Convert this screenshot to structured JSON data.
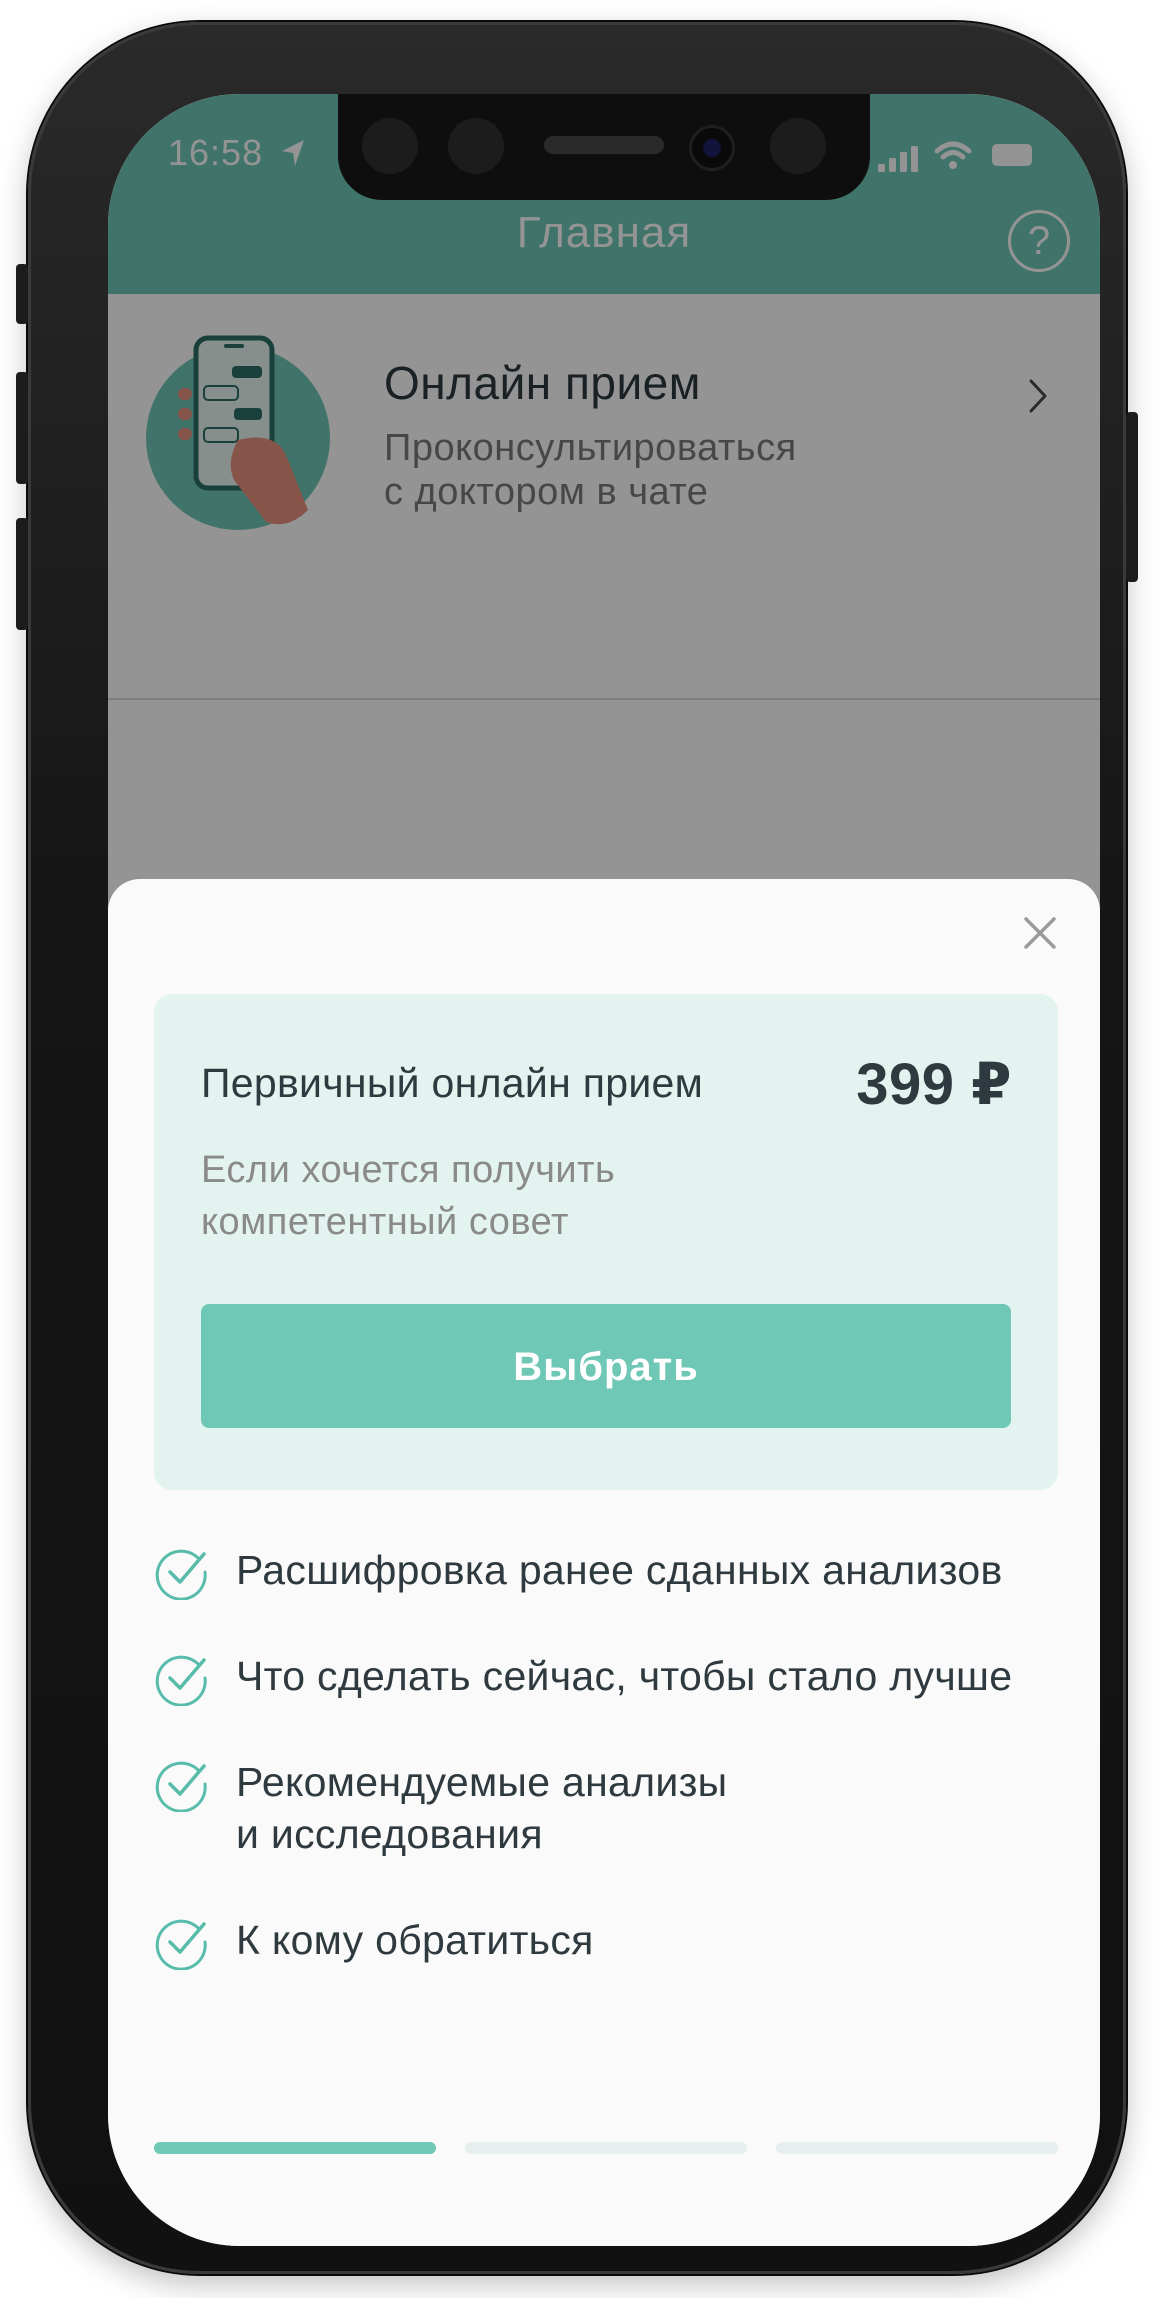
{
  "status_bar": {
    "time": "16:58"
  },
  "header": {
    "title": "Главная",
    "help_label": "?"
  },
  "online_card": {
    "title": "Онлайн прием",
    "subtitle": "Проконсультироваться\nс доктором в чате"
  },
  "offer": {
    "title": "Первичный онлайн прием",
    "price": "399 ₽",
    "description": "Если хочется получить\nкомпетентный совет",
    "choose_label": "Выбрать"
  },
  "features": [
    {
      "text": "Расшифровка ранее сданных анализов"
    },
    {
      "text": "Что сделать сейчас, чтобы стало лучше"
    },
    {
      "text": "Рекомендуемые анализы\nи исследования"
    },
    {
      "text": "К кому обратиться"
    }
  ],
  "pager": {
    "total": 3,
    "active_index": 0
  },
  "colors": {
    "accent": "#6fc7b5",
    "offer_background": "#e3f4f0",
    "text_dark": "#2e3a3f",
    "text_muted": "#8a8a8a"
  },
  "icons": {
    "location": "location-arrow-icon",
    "signal": "cellular-signal-icon",
    "wifi": "wifi-icon",
    "battery": "battery-icon",
    "help": "question-circle-icon",
    "chevron": "chevron-right-icon",
    "close": "close-icon",
    "check": "check-circle-icon"
  }
}
